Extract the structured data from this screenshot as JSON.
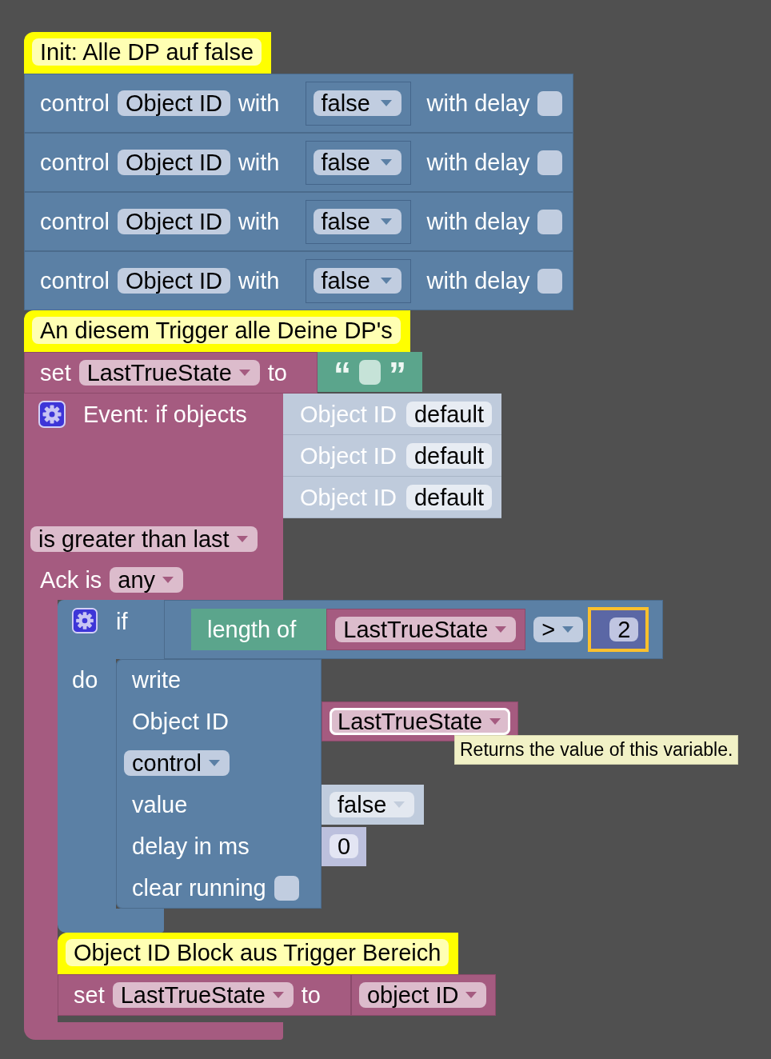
{
  "init_comment": {
    "text": "Init: Alle DP auf false"
  },
  "control_blocks": [
    {
      "label": "control",
      "object_id": "Object ID",
      "with_label": "with",
      "value": "false",
      "delay_label": "with delay",
      "delay_checked": false
    },
    {
      "label": "control",
      "object_id": "Object ID",
      "with_label": "with",
      "value": "false",
      "delay_label": "with delay",
      "delay_checked": false
    },
    {
      "label": "control",
      "object_id": "Object ID",
      "with_label": "with",
      "value": "false",
      "delay_label": "with delay",
      "delay_checked": false
    },
    {
      "label": "control",
      "object_id": "Object ID",
      "with_label": "with",
      "value": "false",
      "delay_label": "with delay",
      "delay_checked": false
    }
  ],
  "trigger_comment": {
    "text": "An diesem Trigger alle Deine DP's"
  },
  "set_block": {
    "label": "set",
    "variable": "LastTrueState",
    "to_label": "to",
    "value": {
      "kind": "text",
      "open_quote": "“",
      "close_quote": "”"
    }
  },
  "event_block": {
    "label": "Event: if objects",
    "objects": [
      {
        "label": "Object ID",
        "value": "default"
      },
      {
        "label": "Object ID",
        "value": "default"
      },
      {
        "label": "Object ID",
        "value": "default"
      }
    ],
    "condition": "is greater than last",
    "ack_label": "Ack is",
    "ack": "any",
    "statements": [
      {
        "kind": "if",
        "if_label": "if",
        "do_label": "do",
        "condition": {
          "function": "length of",
          "variable": "LastTrueState",
          "operator": ">",
          "number": "2",
          "selected": true
        },
        "write_block": {
          "rows": [
            {
              "kind": "label",
              "text": "write"
            },
            {
              "kind": "input",
              "text": "Object ID",
              "input": {
                "kind": "variable",
                "value": "LastTrueState",
                "highlighted": true,
                "tooltip": "Returns the value of this variable."
              }
            },
            {
              "kind": "dropdown",
              "value": "control"
            },
            {
              "kind": "input",
              "text": "value",
              "input": {
                "kind": "dropdown",
                "value": "false"
              }
            },
            {
              "kind": "input",
              "text": "delay in ms",
              "input": {
                "kind": "number",
                "value": "0"
              }
            },
            {
              "kind": "checkbox",
              "text": "clear running",
              "checked": false
            }
          ]
        }
      },
      {
        "kind": "comment",
        "text": "Object ID Block aus Trigger Bereich"
      },
      {
        "kind": "set",
        "label": "set",
        "variable": "LastTrueState",
        "to_label": "to",
        "value": {
          "kind": "dropdown",
          "value": "object ID"
        }
      }
    ]
  }
}
